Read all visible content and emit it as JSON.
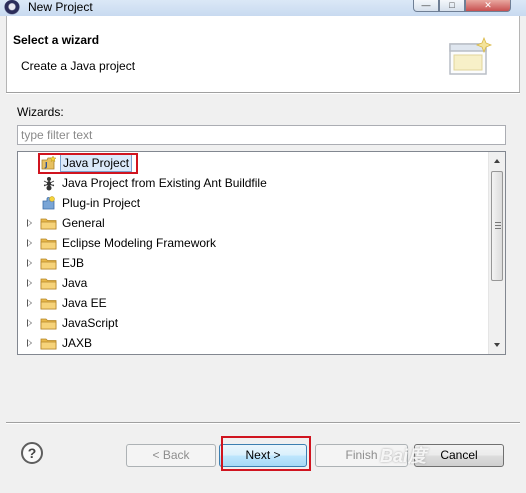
{
  "window": {
    "title": "New Project"
  },
  "header": {
    "title": "Select a wizard",
    "description": "Create a Java project"
  },
  "wizards_label": "Wizards:",
  "filter": {
    "placeholder": "type filter text",
    "value": ""
  },
  "tree": {
    "items": [
      {
        "label": "Java Project",
        "icon": "java-project-icon",
        "expandable": false,
        "selected": true
      },
      {
        "label": "Java Project from Existing Ant Buildfile",
        "icon": "ant-icon",
        "expandable": false,
        "selected": false
      },
      {
        "label": "Plug-in Project",
        "icon": "plugin-icon",
        "expandable": false,
        "selected": false
      },
      {
        "label": "General",
        "icon": "folder-icon",
        "expandable": true,
        "selected": false
      },
      {
        "label": "Eclipse Modeling Framework",
        "icon": "folder-icon",
        "expandable": true,
        "selected": false
      },
      {
        "label": "EJB",
        "icon": "folder-icon",
        "expandable": true,
        "selected": false
      },
      {
        "label": "Java",
        "icon": "folder-icon",
        "expandable": true,
        "selected": false
      },
      {
        "label": "Java EE",
        "icon": "folder-icon",
        "expandable": true,
        "selected": false
      },
      {
        "label": "JavaScript",
        "icon": "folder-icon",
        "expandable": true,
        "selected": false
      },
      {
        "label": "JAXB",
        "icon": "folder-icon",
        "expandable": true,
        "selected": false
      }
    ]
  },
  "buttons": {
    "help": "?",
    "back": "< Back",
    "next": "Next >",
    "finish": "Finish",
    "cancel": "Cancel"
  },
  "watermark": "Bai度"
}
